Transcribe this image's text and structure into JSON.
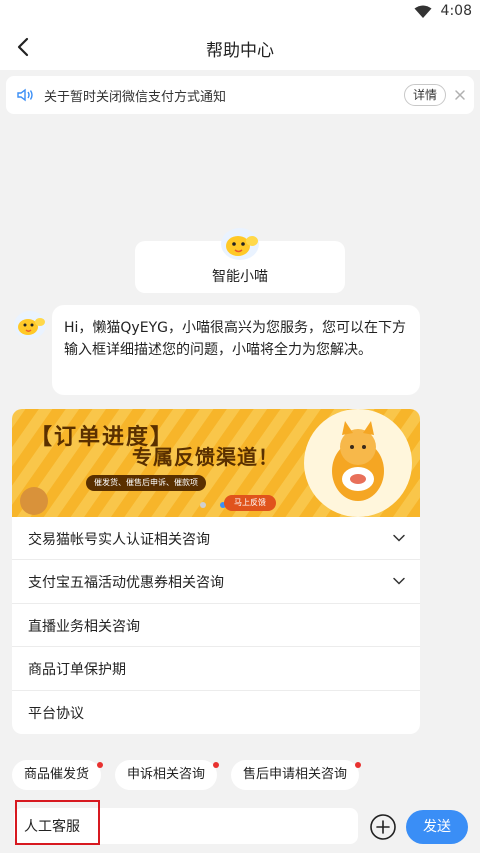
{
  "status_bar": {
    "time": "4:08",
    "wifi_icon": "wifi-icon"
  },
  "header": {
    "title": "帮助中心",
    "back_icon": "back-arrow-icon"
  },
  "notice": {
    "icon": "speaker-icon",
    "text": "关于暂时关闭微信支付方式通知",
    "detail_label": "详情",
    "close_icon": "close-icon"
  },
  "bot": {
    "name": "智能小喵",
    "greeting": "Hi，懒猫QyEYG，小喵很高兴为您服务，您可以在下方输入框详细描述您的问题，小喵将全力为您解决。"
  },
  "banner": {
    "title": "【订单进度】",
    "subtitle": "专属反馈渠道！",
    "tags": "催发货、催售后申诉、催款项",
    "button": "马上反馈"
  },
  "faq": [
    {
      "label": "交易猫帐号实人认证相关咨询",
      "expandable": true
    },
    {
      "label": "支付宝五福活动优惠券相关咨询",
      "expandable": true
    },
    {
      "label": "直播业务相关咨询",
      "expandable": false
    },
    {
      "label": "商品订单保护期",
      "expandable": false
    },
    {
      "label": "平台协议",
      "expandable": false
    }
  ],
  "quick_chips": [
    {
      "label": "商品催发货"
    },
    {
      "label": "申诉相关咨询"
    },
    {
      "label": "售后申请相关咨询"
    }
  ],
  "input": {
    "value": "人工客服",
    "placeholder": ""
  },
  "actions": {
    "send_label": "发送",
    "plus_icon": "plus-circle-icon"
  },
  "colors": {
    "accent": "#3a8ef6",
    "badge": "#e8312f",
    "highlight": "#d71920",
    "banner_yellow": "#f7b52a"
  }
}
